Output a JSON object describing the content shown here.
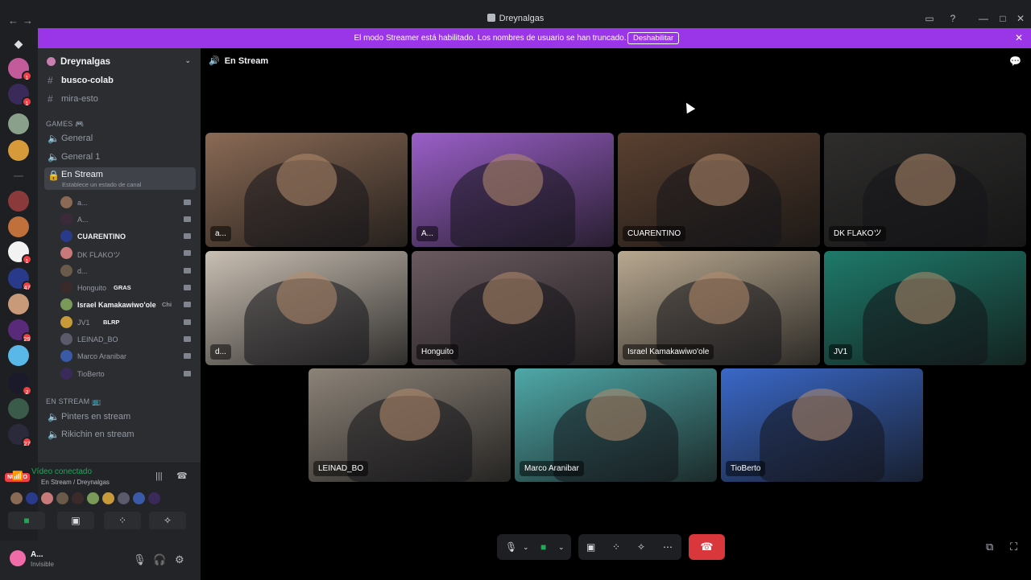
{
  "window": {
    "title": "Dreynalgas"
  },
  "banner": {
    "message": "El modo Streamer está habilitado. Los nombres de usuario se han truncado.",
    "button": "Deshabilitar"
  },
  "server_badges": [
    "1",
    "1",
    "1",
    "47",
    "29",
    "2",
    "27"
  ],
  "nuevo_label": "NUEVO",
  "sidebar": {
    "server_name": "Dreynalgas",
    "channels": [
      {
        "label": "busco-colab",
        "icon": "#"
      },
      {
        "label": "mira-esto",
        "icon": "#"
      }
    ],
    "games_category": "GAMES 🎮",
    "voice_channels": [
      {
        "label": "General"
      },
      {
        "label": "General 1"
      }
    ],
    "active_channel": {
      "label": "En Stream",
      "status": "Establece un estado de canal"
    },
    "members": [
      {
        "name": "a...",
        "tag": ""
      },
      {
        "name": "A...",
        "tag": ""
      },
      {
        "name": "CUARENTINO",
        "tag": ""
      },
      {
        "name": "DK FLAKOツ",
        "tag": ""
      },
      {
        "name": "d...",
        "tag": ""
      },
      {
        "name": "Honguito",
        "tag": "GRAS"
      },
      {
        "name": "Israel Kamakawiwo'ole",
        "tag": "Chi"
      },
      {
        "name": "JV1",
        "tag": "BLRP"
      },
      {
        "name": "LEINAD_BO",
        "tag": ""
      },
      {
        "name": "Marco Aranibar",
        "tag": ""
      },
      {
        "name": "TioBerto",
        "tag": ""
      }
    ],
    "stream_category": "EN STREAM 📺",
    "stream_channels": [
      {
        "label": "Pinters en stream"
      },
      {
        "label": "Rikichin en stream"
      }
    ]
  },
  "voice_panel": {
    "status": "Vídeo conectado",
    "location": "En Stream / Dreynalgas"
  },
  "user": {
    "name": "A...",
    "status": "Invisible"
  },
  "stage": {
    "channel": "En Stream"
  },
  "tiles": [
    {
      "label": "a...",
      "color": "#8a6a55"
    },
    {
      "label": "A...",
      "color": "#9a5fc8"
    },
    {
      "label": "CUARENTINO",
      "color": "#5a4030"
    },
    {
      "label": "DK FLAKOツ",
      "color": "#2e2d2c"
    },
    {
      "label": "d...",
      "color": "#c9bfb3"
    },
    {
      "label": "Honguito",
      "color": "#6a5a60"
    },
    {
      "label": "Israel Kamakawiwo'ole",
      "color": "#b8a890"
    },
    {
      "label": "JV1",
      "color": "#1e7a6a"
    },
    {
      "label": "LEINAD_BO",
      "color": "#8c8378"
    },
    {
      "label": "Marco Aranibar",
      "color": "#4fa8a8"
    },
    {
      "label": "TioBerto",
      "color": "#3a68c8"
    }
  ],
  "colors": {
    "streamer_banner": "#9b35e8",
    "speaking_border": "#23a55a",
    "hangup": "#da373c"
  }
}
